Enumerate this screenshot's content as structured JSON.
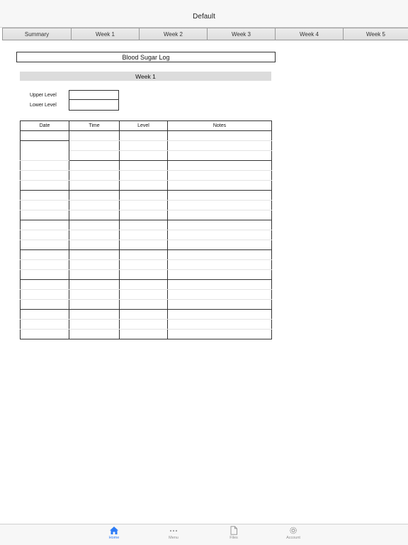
{
  "navbar": {
    "title": "Default"
  },
  "tabs": [
    {
      "label": "Summary"
    },
    {
      "label": "Week 1"
    },
    {
      "label": "Week 2"
    },
    {
      "label": "Week 3"
    },
    {
      "label": "Week 4"
    },
    {
      "label": "Week 5"
    }
  ],
  "sheet": {
    "title": "Blood Sugar Log",
    "week_header": "Week 1",
    "upper_label": "Upper Level",
    "upper_value": "",
    "lower_label": "Lower Level",
    "lower_value": "",
    "columns": [
      "Date",
      "Time",
      "Level",
      "Notes"
    ],
    "day_count": 7,
    "rows_per_day": 3
  },
  "tabbar": {
    "items": [
      {
        "label": "Home",
        "icon": "home-icon",
        "active": true
      },
      {
        "label": "Menu",
        "icon": "more-icon",
        "active": false
      },
      {
        "label": "Files",
        "icon": "file-icon",
        "active": false
      },
      {
        "label": "Account",
        "icon": "gear-icon",
        "active": false
      }
    ],
    "accent": "#2d7cf6"
  }
}
